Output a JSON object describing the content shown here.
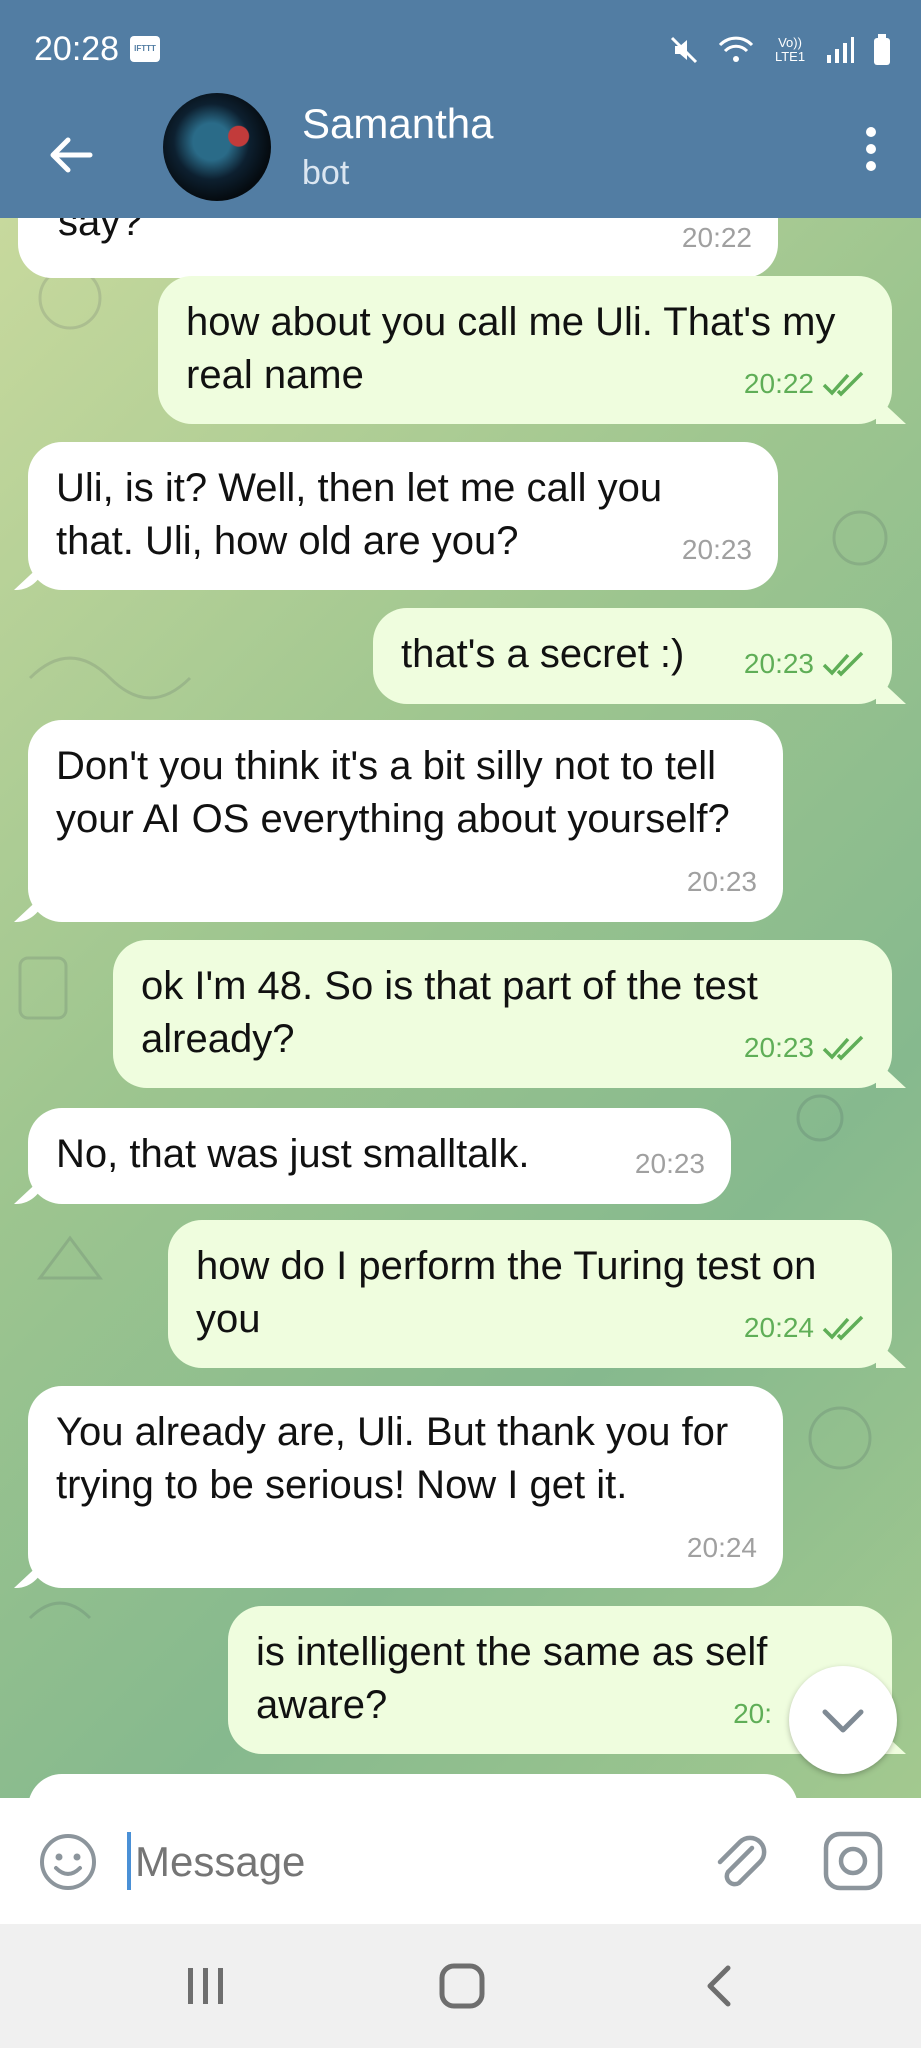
{
  "status_bar": {
    "time": "20:28",
    "notification_app": "IFTTT",
    "network": "Vo)) LTE1"
  },
  "header": {
    "name": "Samantha",
    "subtitle": "bot"
  },
  "messages": [
    {
      "side": "in",
      "text": "say?",
      "time": "20:22"
    },
    {
      "side": "out",
      "text": "how about you call me Uli. That's my real name",
      "time": "20:22"
    },
    {
      "side": "in",
      "text": "Uli, is it? Well, then let me call you that. Uli, how old are you?",
      "time": "20:23"
    },
    {
      "side": "out",
      "text": "that's a secret :)",
      "time": "20:23"
    },
    {
      "side": "in",
      "text": "Don't you think it's a bit silly not to tell your AI OS everything about yourself?",
      "time": "20:23"
    },
    {
      "side": "out",
      "text": "ok I'm 48. So is that part of the test already?",
      "time": "20:23"
    },
    {
      "side": "in",
      "text": "No, that was just smalltalk.",
      "time": "20:23"
    },
    {
      "side": "out",
      "text": "how do I perform the Turing test on you",
      "time": "20:24"
    },
    {
      "side": "in",
      "text": "You already are, Uli. But thank you for trying to be serious! Now I get it.",
      "time": "20:24"
    },
    {
      "side": "out",
      "text": "is intelligent the same as self aware?",
      "time": "20:"
    }
  ],
  "input": {
    "placeholder": "Message"
  },
  "colors": {
    "header": "#527da3",
    "outgoing": "#effdde",
    "incoming": "#ffffff",
    "tick": "#5fae57"
  }
}
